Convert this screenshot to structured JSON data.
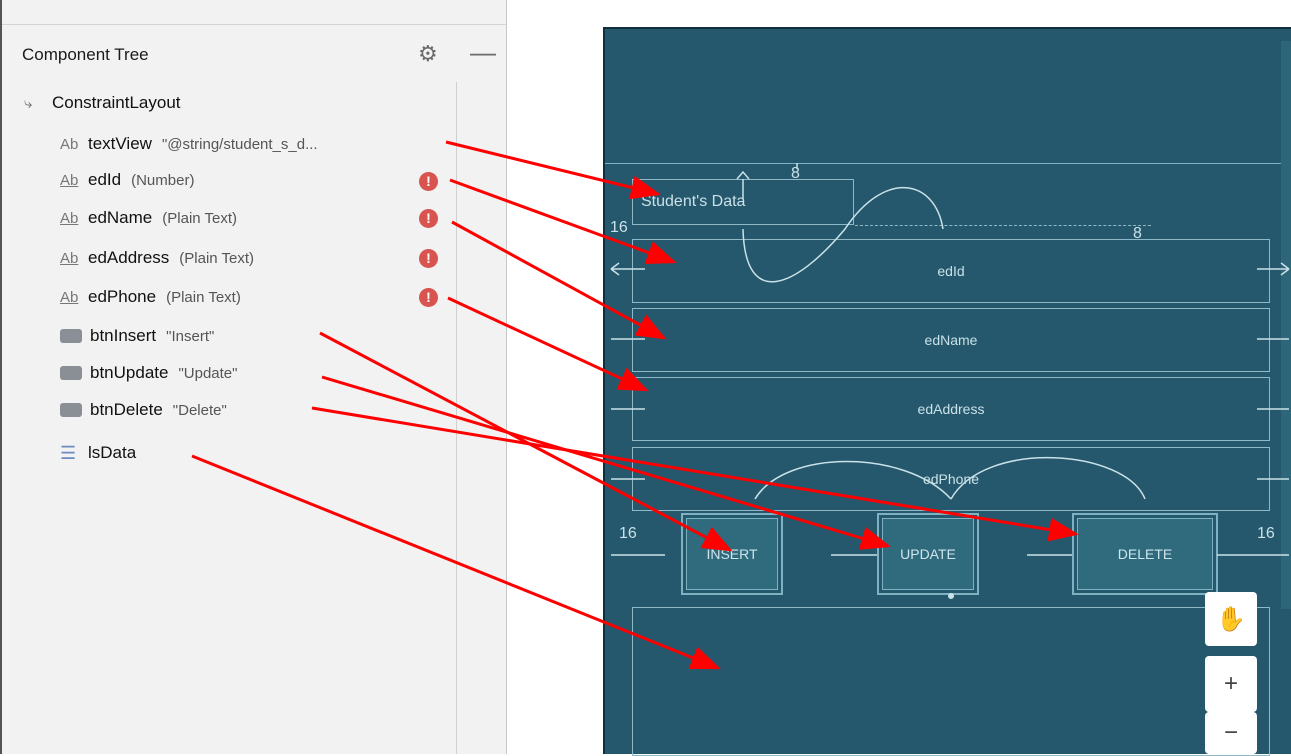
{
  "component_tree": {
    "title": "Component Tree",
    "root": "ConstraintLayout",
    "items": [
      {
        "icon": "Ab",
        "name": "textView",
        "value": "\"@string/student_s_d...",
        "warning": false,
        "type": "text"
      },
      {
        "icon": "Ab",
        "name": "edId",
        "value": "(Number)",
        "warning": true,
        "type": "edit"
      },
      {
        "icon": "Ab",
        "name": "edName",
        "value": "(Plain Text)",
        "warning": true,
        "type": "edit"
      },
      {
        "icon": "Ab",
        "name": "edAddress",
        "value": "(Plain Text)",
        "warning": true,
        "type": "edit"
      },
      {
        "icon": "Ab",
        "name": "edPhone",
        "value": "(Plain Text)",
        "warning": true,
        "type": "edit"
      },
      {
        "icon": "button",
        "name": "btnInsert",
        "value": "\"Insert\"",
        "warning": false,
        "type": "button"
      },
      {
        "icon": "button",
        "name": "btnUpdate",
        "value": "\"Update\"",
        "warning": false,
        "type": "button"
      },
      {
        "icon": "button",
        "name": "btnDelete",
        "value": "\"Delete\"",
        "warning": false,
        "type": "button"
      },
      {
        "icon": "list",
        "name": "lsData",
        "value": "",
        "warning": false,
        "type": "list"
      }
    ],
    "warning_glyph": "!"
  },
  "canvas": {
    "title_text": "Student's Data",
    "fields": [
      "edId",
      "edName",
      "edAddress",
      "edPhone"
    ],
    "buttons": [
      "INSERT",
      "UPDATE",
      "DELETE"
    ],
    "margins": {
      "m8a": "8",
      "m8b": "8",
      "m16a": "16",
      "m16b": "16",
      "m16c": "16"
    }
  },
  "zoom": {
    "hand": "✋",
    "plus": "+",
    "minus": "−"
  },
  "colors": {
    "canvas_bg": "#25586c",
    "arrow": "#ff0000",
    "warning": "#d9534f"
  }
}
